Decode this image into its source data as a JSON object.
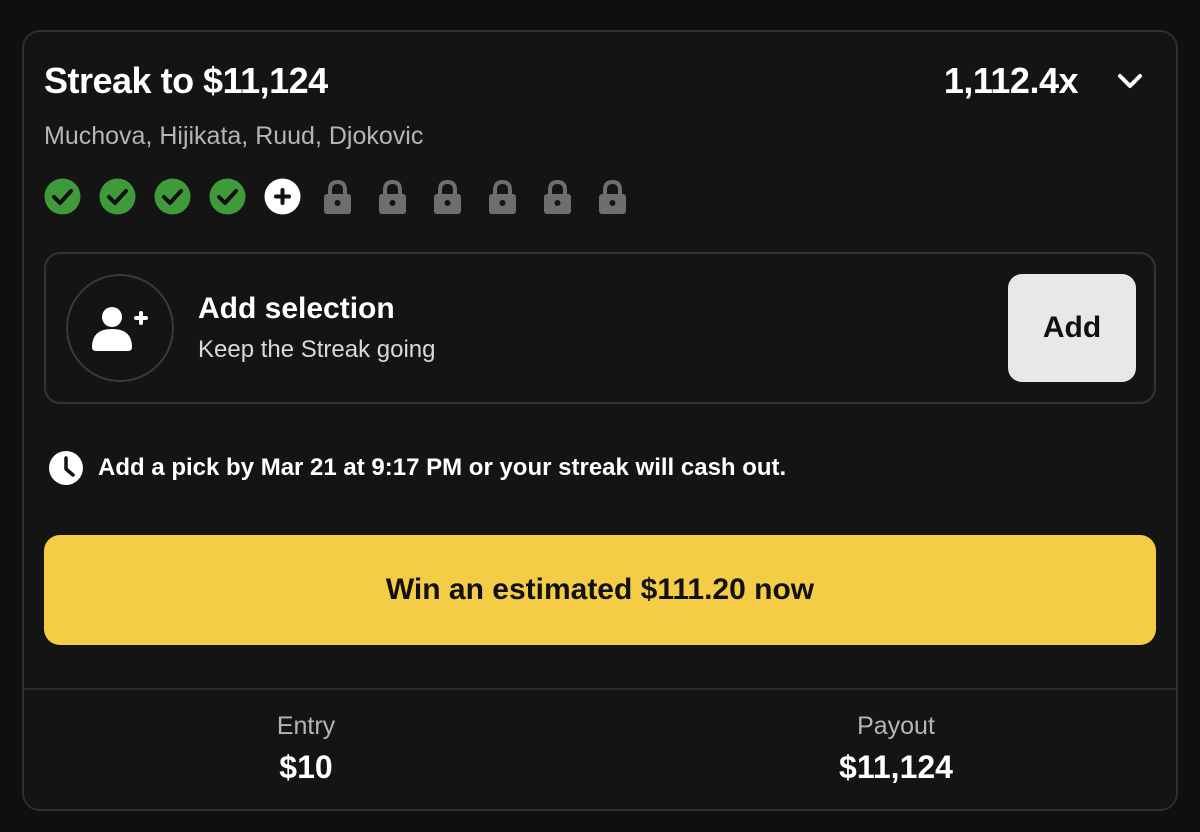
{
  "header": {
    "title": "Streak to $11,124",
    "multiplier": "1,112.4x",
    "players": "Muchova, Hijikata, Ruud, Djokovic"
  },
  "progress": {
    "slots": [
      "check",
      "check",
      "check",
      "check",
      "add",
      "lock",
      "lock",
      "lock",
      "lock",
      "lock",
      "lock"
    ],
    "completed": 4,
    "total": 11
  },
  "add_selection": {
    "title": "Add selection",
    "subtitle": "Keep the Streak going",
    "button_label": "Add"
  },
  "deadline": {
    "text": "Add a pick by Mar 21 at 9:17 PM or your streak will cash out."
  },
  "cashout": {
    "label": "Win an estimated $111.20 now"
  },
  "summary": {
    "entry_label": "Entry",
    "entry_value": "$10",
    "payout_label": "Payout",
    "payout_value": "$11,124"
  },
  "colors": {
    "check_green": "#3f9b3a",
    "cashout_yellow": "#f5cc46",
    "lock_gray": "#6e6e6e",
    "background": "#141414"
  },
  "icons": {
    "expand": "chevron-down-icon",
    "check": "check-circle-icon",
    "add": "plus-circle-icon",
    "lock": "lock-icon",
    "add_user": "add-user-icon",
    "clock": "clock-icon"
  }
}
